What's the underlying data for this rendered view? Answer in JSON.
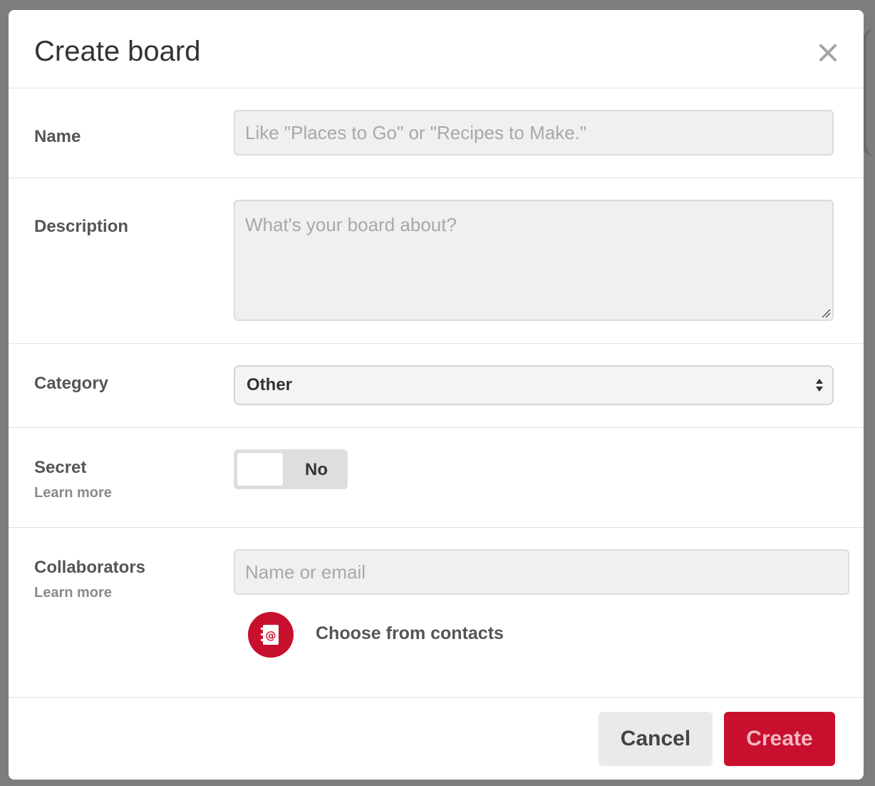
{
  "dialog": {
    "title": "Create board",
    "close_icon": "close-icon"
  },
  "form": {
    "name": {
      "label": "Name",
      "placeholder": "Like \"Places to Go\" or \"Recipes to Make.\"",
      "value": ""
    },
    "description": {
      "label": "Description",
      "placeholder": "What's your board about?",
      "value": ""
    },
    "category": {
      "label": "Category",
      "selected": "Other"
    },
    "secret": {
      "label": "Secret",
      "learn_more": "Learn more",
      "toggle_text": "No",
      "enabled": false
    },
    "collaborators": {
      "label": "Collaborators",
      "learn_more": "Learn more",
      "placeholder": "Name or email",
      "value": "",
      "contacts_label": "Choose from contacts",
      "contacts_icon": "address-book-icon"
    }
  },
  "footer": {
    "cancel_label": "Cancel",
    "create_label": "Create"
  },
  "colors": {
    "accent": "#c8102e",
    "overlay": "#7d7d7d"
  }
}
